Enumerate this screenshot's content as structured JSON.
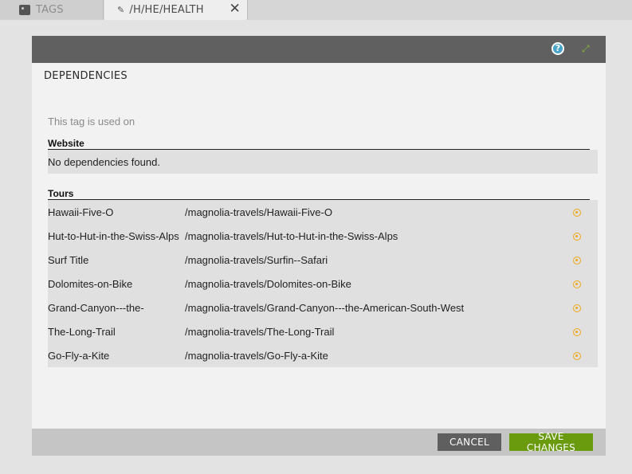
{
  "tabs": [
    {
      "label": "TAGS",
      "icon": "tag-icon"
    },
    {
      "label": "/H/HE/HEALTH",
      "icon": "pencil-icon",
      "close": "✕"
    }
  ],
  "panel": {
    "title": "DEPENDENCIES",
    "help_icon": "?",
    "intro": "This tag is used on"
  },
  "website": {
    "heading": "Website",
    "empty_text": "No dependencies found."
  },
  "tours": {
    "heading": "Tours",
    "rows": [
      {
        "name": "Hawaii-Five-O",
        "path": "/magnolia-travels/Hawaii-Five-O"
      },
      {
        "name": "Hut-to-Hut-in-the-Swiss-Alps",
        "path": "/magnolia-travels/Hut-to-Hut-in-the-Swiss-Alps"
      },
      {
        "name": "Surf Title",
        "path": "/magnolia-travels/Surfin--Safari"
      },
      {
        "name": "Dolomites-on-Bike",
        "path": "/magnolia-travels/Dolomites-on-Bike"
      },
      {
        "name": "Grand-Canyon---the-",
        "path": "/magnolia-travels/Grand-Canyon---the-American-South-West"
      },
      {
        "name": "The-Long-Trail",
        "path": "/magnolia-travels/The-Long-Trail"
      },
      {
        "name": "Go-Fly-a-Kite",
        "path": "/magnolia-travels/Go-Fly-a-Kite"
      }
    ]
  },
  "footer": {
    "cancel_label": "CANCEL",
    "save_label": "SAVE CHANGES"
  },
  "colors": {
    "header_bg": "#606060",
    "accent_green": "#6a9b0f",
    "status_orange": "#f0a817",
    "help_blue": "#4aa3c8"
  }
}
